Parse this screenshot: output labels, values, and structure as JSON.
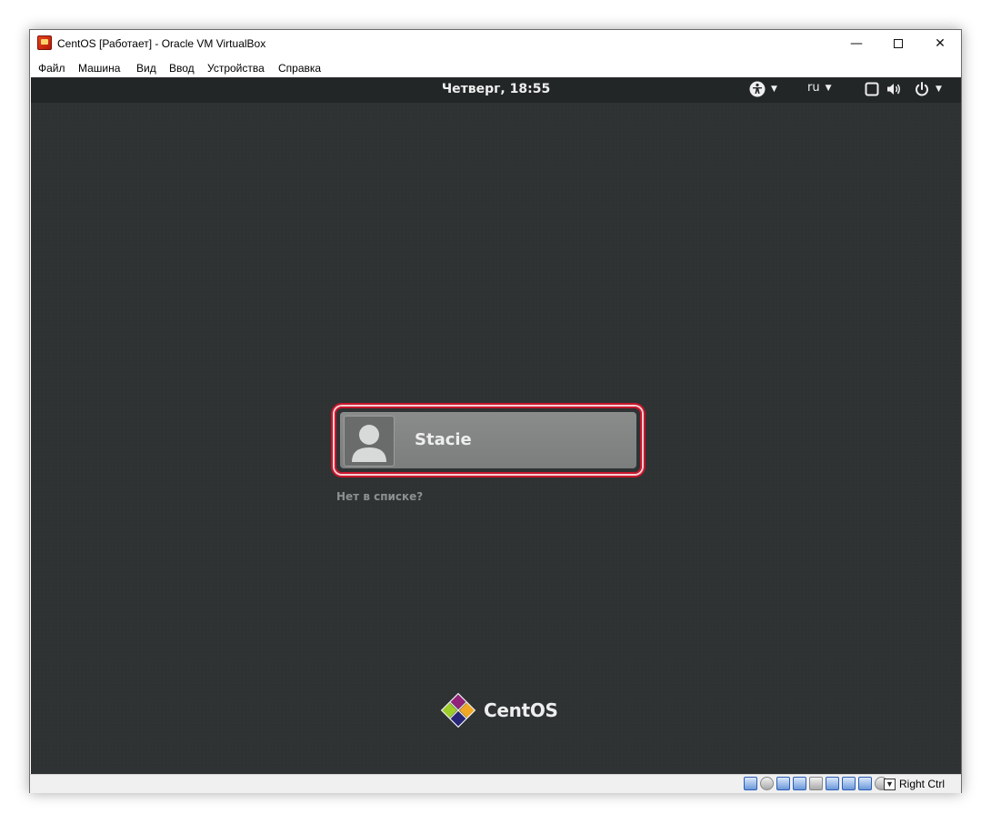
{
  "window": {
    "title": "CentOS [Работает] - Oracle VM VirtualBox",
    "minimize_glyph": "—",
    "close_glyph": "✕"
  },
  "menu": {
    "items": [
      "Файл",
      "Машина",
      "Вид",
      "Ввод",
      "Устройства",
      "Справка"
    ]
  },
  "guest": {
    "panel": {
      "clock": "Четверг, 18:55",
      "language": "ru",
      "icons": [
        "accessibility-icon",
        "screen-icon",
        "volume-icon",
        "power-icon"
      ]
    },
    "login": {
      "user_name": "Stacie",
      "not_listed": "Нет в списке?"
    },
    "brand": "CentOS"
  },
  "statusbar": {
    "host_key": "Right Ctrl",
    "icons": [
      "hard-disk-icon",
      "optical-drive-icon",
      "network-icon",
      "usb-icon",
      "shared-folders-icon",
      "display-icon",
      "video-capture-icon",
      "cpu-virtualization-icon",
      "mouse-integration-icon"
    ]
  },
  "colors": {
    "guest_background": "#2e3233",
    "highlight": "#c8162c"
  }
}
